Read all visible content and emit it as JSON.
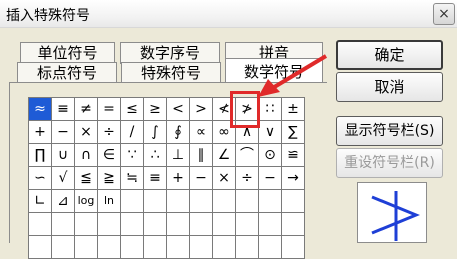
{
  "window": {
    "title": "插入特殊符号",
    "close_glyph": "×"
  },
  "tabs": [
    {
      "label": "单位符号",
      "active": false
    },
    {
      "label": "数字序号",
      "active": false
    },
    {
      "label": "拼音",
      "active": false
    },
    {
      "label": "标点符号",
      "active": false
    },
    {
      "label": "特殊符号",
      "active": false
    },
    {
      "label": "数学符号",
      "active": true
    }
  ],
  "grid": {
    "rows": [
      [
        "≈",
        "≡",
        "≠",
        "=",
        "≤",
        "≥",
        "<",
        ">",
        "≮",
        "≯",
        "∷",
        "±"
      ],
      [
        "+",
        "−",
        "×",
        "÷",
        "/",
        "∫",
        "∮",
        "∝",
        "∞",
        "∧",
        "∨",
        "∑"
      ],
      [
        "∏",
        "∪",
        "∩",
        "∈",
        "∵",
        "∴",
        "⊥",
        "∥",
        "∠",
        "⌒",
        "⊙",
        "≌"
      ],
      [
        "∽",
        "√",
        "≦",
        "≧",
        "≒",
        "≡",
        "+",
        "−",
        "×",
        "÷",
        "−",
        "→"
      ],
      [
        "∟",
        "⊿",
        "log",
        "ln",
        "",
        "",
        "",
        "",
        "",
        "",
        "",
        ""
      ],
      [
        "",
        "",
        "",
        "",
        "",
        "",
        "",
        "",
        "",
        "",
        "",
        ""
      ],
      [
        "",
        "",
        "",
        "",
        "",
        "",
        "",
        "",
        "",
        "",
        "",
        ""
      ]
    ],
    "selected": "≈",
    "highlighted": "≯"
  },
  "buttons": {
    "ok": "确定",
    "cancel": "取消",
    "show_toolbar": "显示符号栏(S)",
    "reset_toolbar": "重设符号栏(R)"
  },
  "preview": {
    "symbol": "≯"
  },
  "colors": {
    "selection": "#1e5bd6",
    "annotation": "#e02a2a"
  }
}
